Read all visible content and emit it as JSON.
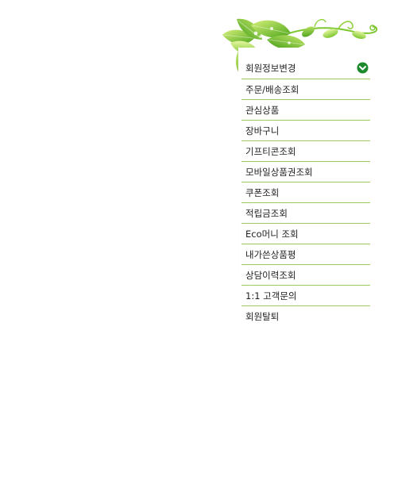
{
  "menu": {
    "items": [
      {
        "label": "회원정보변경"
      },
      {
        "label": "주문/배송조회"
      },
      {
        "label": "관심상품"
      },
      {
        "label": "장바구니"
      },
      {
        "label": "기프티콘조회"
      },
      {
        "label": "모바일상품권조회"
      },
      {
        "label": "쿠폰조회"
      },
      {
        "label": "적립금조회"
      },
      {
        "label": "Eco머니 조회"
      },
      {
        "label": "내가쓴상품평"
      },
      {
        "label": "상담이력조회"
      },
      {
        "label": "1:1 고객문의"
      },
      {
        "label": "회원탈퇴"
      }
    ]
  },
  "colors": {
    "divider": "#9dcc5c",
    "active_icon": "#1e8a2e",
    "leaf_light": "#a8dc3c",
    "leaf_dark": "#4da51a"
  },
  "icons": {
    "active_item": "chevron-down-icon",
    "decoration": "leaves-icon"
  }
}
